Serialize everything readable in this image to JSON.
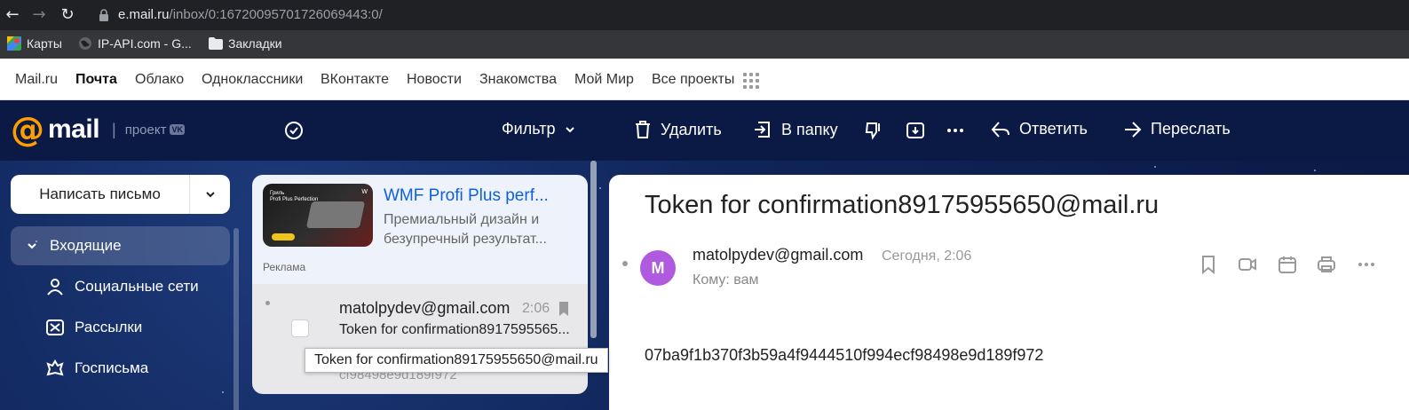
{
  "browser": {
    "url_host": "e.mail.ru",
    "url_path": "/inbox/0:16720095701726069443:0/",
    "bookmarks": [
      "Карты",
      "IP-API.com - G...",
      "Закладки"
    ]
  },
  "portal_nav": {
    "items": [
      "Mail.ru",
      "Почта",
      "Облако",
      "Одноклассники",
      "ВКонтакте",
      "Новости",
      "Знакомства",
      "Мой Мир",
      "Все проекты"
    ]
  },
  "toolbar": {
    "logo_word": "mail",
    "logo_project": "проект",
    "logo_vk": "VK",
    "filter_label": "Фильтр",
    "delete_label": "Удалить",
    "move_label": "В папку",
    "reply_label": "Ответить",
    "forward_label": "Переслать"
  },
  "sidebar": {
    "compose_label": "Написать письмо",
    "items": [
      {
        "label": "Входящие",
        "icon": "chevron-down-icon"
      },
      {
        "label": "Социальные сети",
        "icon": "social-icon"
      },
      {
        "label": "Рассылки",
        "icon": "newsletter-icon"
      },
      {
        "label": "Госписьма",
        "icon": "gov-emblem-icon"
      }
    ]
  },
  "message_list": {
    "ad": {
      "title": "WMF Profi Plus perf...",
      "text_line1": "Премиальный дизайн и",
      "text_line2": "безупречный результат...",
      "label": "Реклама",
      "image_caption1": "Гриль",
      "image_caption2": "Profi Plus Perfection"
    },
    "messages": [
      {
        "from": "matolpydev@gmail.com",
        "time": "2:06",
        "subject": "Token for confirmation8917595565...",
        "snippet": "cf98498e9d189f972"
      }
    ]
  },
  "tooltip": "Token for confirmation89175955650@mail.ru",
  "reader": {
    "subject": "Token for confirmation89175955650@mail.ru",
    "avatar_letter": "M",
    "sender": "matolpydev@gmail.com",
    "date": "Сегодня, 2:06",
    "to": "Кому: вам",
    "body": "07ba9f1b370f3b59a4f9444510f994ecf98498e9d189f972"
  },
  "colors": {
    "toolbar_bg": "#0b1a45",
    "logo_accent": "#ff9e00",
    "link_blue": "#1060d8",
    "avatar_bg": "#b05ae0"
  }
}
